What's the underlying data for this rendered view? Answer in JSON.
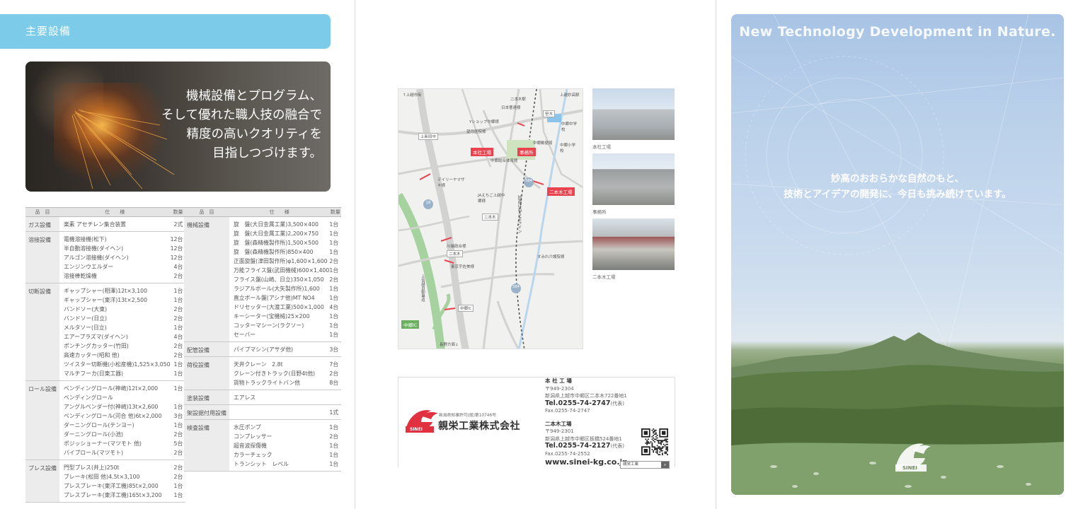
{
  "panel1": {
    "header": "主要設備",
    "hero_lines": [
      "機械設備とプログラム、",
      "そして優れた職人技の融合で",
      "精度の高いクオリティを",
      "目指しつづけます。"
    ],
    "table_headers": {
      "item": "品　目",
      "spec": "仕　　様",
      "qty": "数量"
    },
    "left_table": [
      {
        "cat": "ガス設備",
        "specs": [
          "楽素 アセチレン集合装置"
        ],
        "qtys": [
          "2式"
        ]
      },
      {
        "cat": "溶接設備",
        "specs": [
          "電機溶接機(松下)",
          "半自動溶接機(ダイヘン)",
          "アルゴン溶接機(ダイヘン)",
          "エンジンウエルダー",
          "溶接棒乾燥機"
        ],
        "qtys": [
          "12台",
          "12台",
          "12台",
          "4台",
          "2台"
        ]
      },
      {
        "cat": "切断設備",
        "specs": [
          "ギャップシャー(相澤)12t×3,100",
          "ギャップシャー(東洋)13t×2,500",
          "バンドソー(大東)",
          "バンドソー(日立)",
          "メルタソー(日立)",
          "エアープラズマ(ダイヘン)",
          "ポンチングカッター(竹田)",
          "高速カッター(昭和 他)",
          "ツイスター切断機(小松産機)1,525×3,050",
          "マルチフーカ(日東工器)"
        ],
        "qtys": [
          "1台",
          "1台",
          "2台",
          "2台",
          "1台",
          "4台",
          "2台",
          "2台",
          "1台",
          "1台"
        ]
      },
      {
        "cat": "ロール設備",
        "specs": [
          "ベンディングロール(神崎)12t×2,000",
          "ベンディングロール",
          "アングルベンダー付(神崎)13t×2,600",
          "ベンディングロール(河合 他)6t×2,000",
          "ダーニングロール(テンヨー)",
          "ダーニングロール(小池)",
          "ポジッショーナー(マツモト 他)",
          "パイプロール(マツモト)"
        ],
        "qtys": [
          "1台",
          "",
          "1台",
          "3台",
          "1台",
          "2台",
          "5台",
          "2台"
        ]
      },
      {
        "cat": "プレス設備",
        "specs": [
          "門型プレス(井上)250t",
          "ブレーキ(松田 他)4.5t×3,100",
          "プレスブレーキ(東洋工機)85t×2,000",
          "プレスブレーキ(東洋工機)165t×3,200"
        ],
        "qtys": [
          "2台",
          "2台",
          "1台",
          "1台"
        ]
      }
    ],
    "right_table": [
      {
        "cat": "機械設備",
        "specs": [
          "旋　盤(大日金属工業)3,500×400",
          "旋　盤(大日金属工業)2,200×750",
          "旋　盤(森精機製作所)1,500×500",
          "旋　盤(森精機製作所)850×400",
          "正面旋盤(津田製作所)φ1,600×1,600",
          "万能フライス盤(武田機械)600×1,400",
          "フライス盤(山崎、日立)350×1,050",
          "ラジアルボール(大矢製作所)1,600",
          "直立ボール盤(アシナ他)MT NO4",
          "ドリセッター(大渡工業)500×1,000",
          "キーシーター(宝機械)25×200",
          "コッターマシーン(ラクソー)",
          "セーバー"
        ],
        "qtys": [
          "1台",
          "1台",
          "1台",
          "1台",
          "2台",
          "1台",
          "2台",
          "1台",
          "1台",
          "4台",
          "1台",
          "1台",
          "1台"
        ]
      },
      {
        "cat": "配管設備",
        "specs": [
          "パイプマシン(アサダ他)"
        ],
        "qtys": [
          "3台"
        ]
      },
      {
        "cat": "荷役設備",
        "specs": [
          "天井クレーン　2.8t",
          "クレーン付きトラック(日野4t他)",
          "貨物トラックライトバン他"
        ],
        "qtys": [
          "7台",
          "2台",
          "8台"
        ]
      },
      {
        "cat": "塗装設備",
        "specs": [
          "エアレス"
        ],
        "qtys": [
          ""
        ]
      },
      {
        "cat": "架設据付用設備",
        "specs": [
          ""
        ],
        "qtys": [
          "1式"
        ]
      },
      {
        "cat": "検査設備",
        "specs": [
          "水圧ポンプ",
          "コンプレッサー",
          "超音波探傷機",
          "カラーチェック",
          "トランシット　レベル"
        ],
        "qtys": [
          "1台",
          "2台",
          "1台",
          "1台",
          "1台"
        ]
      }
    ]
  },
  "panel2": {
    "map_labels": {
      "to_joetsu": "↑上越市街",
      "joetsu_myoko_st": "上越妙高駅",
      "nihongi_st": "二本木駅",
      "nihon_soda": "日本曹達様",
      "yshop": "Yショップ中郷様",
      "hospital": "望月医院様",
      "head_factory": "本社工場",
      "office": "事務所",
      "chugo_post": "中郷郵便局",
      "chugo_jhs": "中郷中学校",
      "chugo_es": "中郷小学校",
      "gym": "中郷総合体育館",
      "daily": "デイリーヤマザキ様",
      "ja": "JAえちご上越中郷様",
      "nihongi": "二本木",
      "myoko_haneuma": "妙高はねうまライン",
      "nihongi_factory": "二本木工場",
      "kawabata": "川端政合様",
      "tokyo_ent": "東京宇佐美様",
      "sumire": "すみれ介護院様",
      "expressway": "上信越自動車道",
      "chugo_ic": "中郷IC",
      "chugo_ic_box": "中郷IC",
      "to_nagano": "長野方面↓",
      "sasa": "笹木",
      "kamishinden": "上新田中",
      "route18": "18",
      "route584": "584",
      "nihongi_box": "二本木"
    },
    "photo_labels": [
      "本社工場",
      "事務所",
      "二本木工場"
    ],
    "company": {
      "logo_text": "SINEI",
      "permit": "新潟県知事許可(般)第10746号",
      "name": "親栄工業株式会社",
      "hq_heading": "本 社 工 場",
      "hq_zip": "〒949-2304",
      "hq_addr": "新潟県上越市中郷区二本木722番地1",
      "hq_tel": "Tel.0255-74-2747",
      "hq_tel_note": "(代表)",
      "hq_fax": "Fax.0255-74-2747",
      "fac_heading": "二本木工場",
      "fac_zip": "〒949-2301",
      "fac_addr": "新潟県上越市中郷区板橋524番地1",
      "fac_tel": "Tel.0255-74-2127",
      "fac_tel_note": "(代表)",
      "fac_fax": "Fax.0255-74-2552",
      "url": "www.sinei-kg.co.jp",
      "search_text": "親栄工業",
      "search_icon": "search-icon"
    }
  },
  "panel3": {
    "title": "New Technology Development in Nature.",
    "lines": [
      "妙高のおおらかな自然のもと、",
      "技術とアイデアの開発に、今日も挑み続けています。"
    ],
    "logo_text": "SINEI"
  },
  "colors": {
    "accent": "#7bcbe9",
    "brand_red": "#e1303f",
    "map_red": "#e9434f"
  }
}
